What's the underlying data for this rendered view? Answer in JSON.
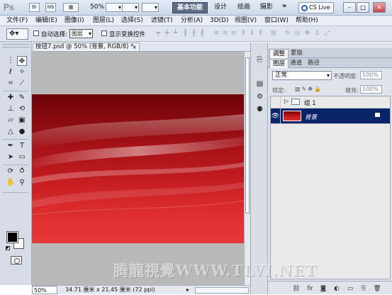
{
  "titlebar": {
    "app_logo": "Ps",
    "br_label": "Br",
    "mb_label": "Mb",
    "zoom": "50%",
    "workspace_tabs": [
      "基本功能",
      "设计",
      "绘画",
      "摄影"
    ],
    "more": "»",
    "cs_live": "CS Live",
    "window_buttons": [
      "–",
      "□",
      "✕"
    ]
  },
  "menu": [
    "文件(F)",
    "编辑(E)",
    "图像(I)",
    "图层(L)",
    "选择(S)",
    "滤镜(T)",
    "分析(A)",
    "3D(D)",
    "视图(V)",
    "窗口(W)",
    "帮助(H)"
  ],
  "options": {
    "auto_select_label": "自动选择:",
    "auto_select_target": "图层",
    "show_transform_label": "显示变换控件"
  },
  "document": {
    "tab_title": "按钮7.psd @ 50% (背景, RGB/8) *",
    "tab_close": "×",
    "status_zoom": "50%",
    "status_docsize": "34.71 厘米 x 21.45 厘米 (72 ppi)",
    "status_arrow": "▸"
  },
  "panels": {
    "top_tabs": [
      "调整",
      "蒙版"
    ],
    "layer_tabs": [
      "图层",
      "通道",
      "路径"
    ],
    "blend_mode": "正常",
    "opacity_label": "不透明度:",
    "opacity_value": "100%",
    "lock_label": "锁定:",
    "fill_label": "填充:",
    "fill_value": "100%",
    "layers": [
      {
        "name": "组 1",
        "type": "group",
        "visible": false
      },
      {
        "name": "背景",
        "type": "background",
        "visible": true,
        "selected": true
      }
    ],
    "footer_icons": [
      "link-icon",
      "fx-icon",
      "mask-icon",
      "adjustment-icon",
      "folder-icon",
      "new-layer-icon",
      "trash-icon"
    ]
  },
  "tools": [
    "move-tool-icon",
    "marquee-tool-icon",
    "lasso-tool-icon",
    "magic-wand-icon",
    "crop-tool-icon",
    "eyedropper-icon",
    "healing-brush-icon",
    "brush-icon",
    "clone-stamp-icon",
    "history-brush-icon",
    "eraser-icon",
    "gradient-icon",
    "blur-icon",
    "dodge-icon",
    "pen-icon",
    "type-icon",
    "path-select-icon",
    "shape-icon",
    "3d-rotate-icon",
    "3d-orbit-icon",
    "hand-icon",
    "zoom-icon"
  ],
  "colors": {
    "foreground": "#000000",
    "background": "#ffffff",
    "active_workspace": "#5e6d84",
    "selected_layer": "#0a246a"
  },
  "watermark": "腾龍視覺WWW.TLVI.NET"
}
